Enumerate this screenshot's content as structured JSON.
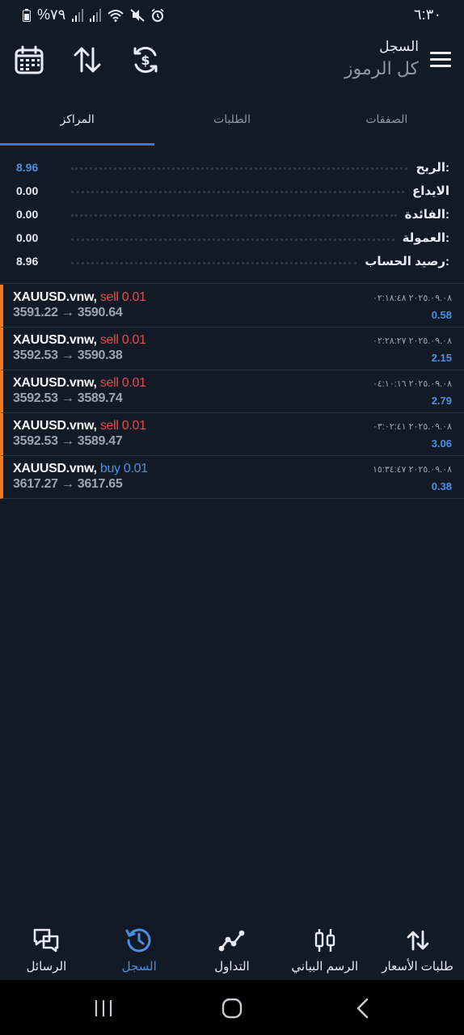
{
  "status_bar": {
    "battery_text": "%٧٩",
    "time": "٦:٣٠"
  },
  "header": {
    "title": "السجل",
    "subtitle": "كل الرموز"
  },
  "tabs": [
    {
      "label": "المراكز",
      "active": true
    },
    {
      "label": "الطلبات",
      "active": false
    },
    {
      "label": "الصفقات",
      "active": false
    }
  ],
  "summary": [
    {
      "label": "الربح:",
      "value": "8.96",
      "highlight": true
    },
    {
      "label": "الايداع",
      "value": "0.00",
      "highlight": false
    },
    {
      "label": "الفائدة:",
      "value": "0.00",
      "highlight": false
    },
    {
      "label": "العمولة:",
      "value": "0.00",
      "highlight": false
    },
    {
      "label": "رصيد الحساب:",
      "value": "8.96",
      "highlight": false
    }
  ],
  "trades": [
    {
      "symbol": "XAUUSD.vnw,",
      "side": "sell 0.01",
      "type": "sell",
      "prices": "3591.22 → 3590.64",
      "time": "٢٠٢٥.٠٩.٠٨ ٠٢:١٨:٤٨",
      "profit": "0.58"
    },
    {
      "symbol": "XAUUSD.vnw,",
      "side": "sell 0.01",
      "type": "sell",
      "prices": "3592.53 → 3590.38",
      "time": "٢٠٢٥.٠٩.٠٨ ٠٢:٢٨:٢٧",
      "profit": "2.15"
    },
    {
      "symbol": "XAUUSD.vnw,",
      "side": "sell 0.01",
      "type": "sell",
      "prices": "3592.53 → 3589.74",
      "time": "٢٠٢٥.٠٩.٠٨ ٠٤:١٠:١٦",
      "profit": "2.79"
    },
    {
      "symbol": "XAUUSD.vnw,",
      "side": "sell 0.01",
      "type": "sell",
      "prices": "3592.53 → 3589.47",
      "time": "٢٠٢٥.٠٩.٠٨ ٠٣:٠٢:٤١",
      "profit": "3.06"
    },
    {
      "symbol": "XAUUSD.vnw,",
      "side": "buy 0.01",
      "type": "buy",
      "prices": "3617.27 → 3617.65",
      "time": "٢٠٢٥.٠٩.٠٨ ١٥:٣٤:٤٧",
      "profit": "0.38"
    }
  ],
  "bottom_nav": [
    {
      "label": "الرسائل",
      "icon": "messages-icon",
      "active": false
    },
    {
      "label": "السجل",
      "icon": "history-icon",
      "active": true
    },
    {
      "label": "التداول",
      "icon": "trade-icon",
      "active": false
    },
    {
      "label": "الرسم البياني",
      "icon": "chart-icon",
      "active": false
    },
    {
      "label": "طلبات الأسعار",
      "icon": "quotes-icon",
      "active": false
    }
  ],
  "colors": {
    "background": "#121a26",
    "accent": "#2f7de1",
    "sell": "#e5484d",
    "buy": "#4a90e2",
    "position_marker": "#f07a1d"
  }
}
